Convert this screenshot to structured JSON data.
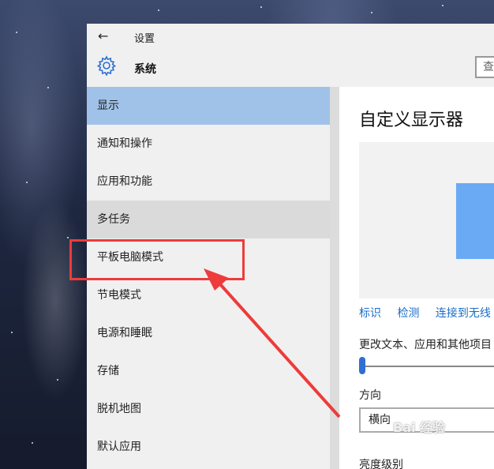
{
  "window": {
    "title": "设置"
  },
  "header": {
    "title": "系统",
    "search_placeholder": "查"
  },
  "sidebar": {
    "items": [
      {
        "label": "显示",
        "state": "selected"
      },
      {
        "label": "通知和操作",
        "state": ""
      },
      {
        "label": "应用和功能",
        "state": ""
      },
      {
        "label": "多任务",
        "state": "hover"
      },
      {
        "label": "平板电脑模式",
        "state": "highlighted"
      },
      {
        "label": "节电模式",
        "state": ""
      },
      {
        "label": "电源和睡眠",
        "state": ""
      },
      {
        "label": "存储",
        "state": ""
      },
      {
        "label": "脱机地图",
        "state": ""
      },
      {
        "label": "默认应用",
        "state": ""
      }
    ]
  },
  "content": {
    "title": "自定义显示器",
    "links": [
      "标识",
      "检测",
      "连接到无线"
    ],
    "scale_label": "更改文本、应用和其他项目",
    "scale_value_percent": 0,
    "orientation_label": "方向",
    "orientation_value": "横向",
    "brightness_label": "亮度级别"
  },
  "colors": {
    "selected": "#a0c2e8",
    "hover": "#dadada",
    "accent": "#2f6fd0",
    "annotation": "#ee3b3b"
  },
  "watermark": "Bai 经验"
}
